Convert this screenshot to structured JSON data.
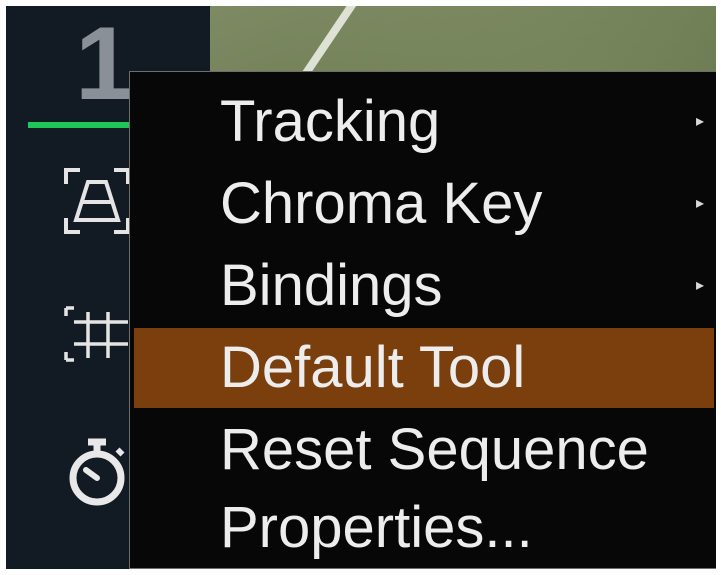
{
  "panel": {
    "track_number": "1",
    "tools": [
      {
        "icon": "perspective-tracking-icon"
      },
      {
        "icon": "grid-tracking-icon"
      },
      {
        "icon": "stopwatch-icon"
      }
    ]
  },
  "menu": {
    "items": [
      {
        "label": "Tracking",
        "submenu": true,
        "arrow": "▸"
      },
      {
        "label": "Chroma Key",
        "submenu": true,
        "arrow": "▸"
      },
      {
        "label": "Bindings",
        "submenu": true,
        "arrow": "▸"
      },
      {
        "label": "Default Tool",
        "submenu": false,
        "highlighted": true
      },
      {
        "label": "Reset Sequence",
        "submenu": false
      },
      {
        "label": "Properties...",
        "submenu": false
      }
    ]
  },
  "colors": {
    "highlight": "#7a3f0d",
    "active_track": "#1fc65a",
    "menu_background": "#070707",
    "panel_background": "#121a24"
  }
}
